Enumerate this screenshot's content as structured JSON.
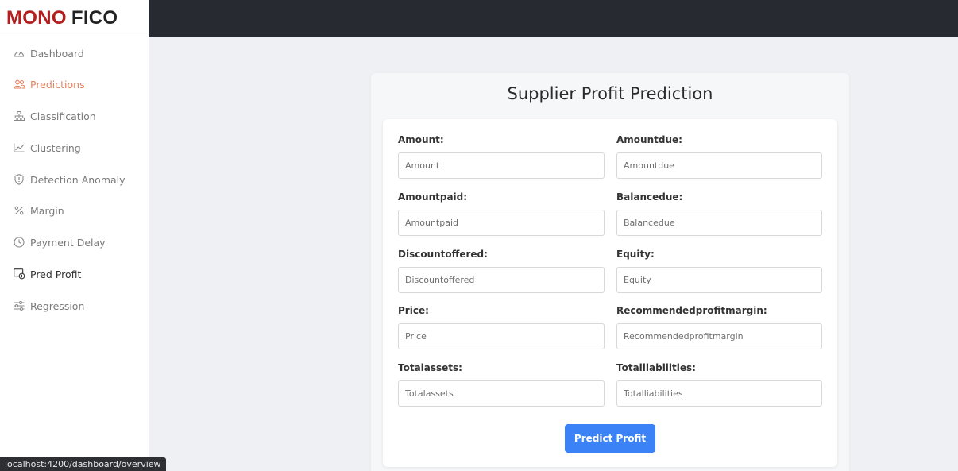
{
  "logo": {
    "part1": "MONO",
    "part2": "FICO"
  },
  "sidebar": {
    "items": [
      {
        "label": "Dashboard",
        "icon": "gauge-icon"
      },
      {
        "label": "Predictions",
        "icon": "users-icon"
      },
      {
        "label": "Classification",
        "icon": "sitemap-icon"
      },
      {
        "label": "Clustering",
        "icon": "line-chart-icon"
      },
      {
        "label": "Detection Anomaly",
        "icon": "shield-icon"
      },
      {
        "label": "Margin",
        "icon": "percent-icon"
      },
      {
        "label": "Payment Delay",
        "icon": "clock-icon"
      },
      {
        "label": "Pred Profit",
        "icon": "money-check-icon"
      },
      {
        "label": "Regression",
        "icon": "sliders-icon"
      }
    ]
  },
  "form": {
    "title": "Supplier Profit Prediction",
    "fields": [
      {
        "label": "Amount:",
        "placeholder": "Amount"
      },
      {
        "label": "Amountdue:",
        "placeholder": "Amountdue"
      },
      {
        "label": "Amountpaid:",
        "placeholder": "Amountpaid"
      },
      {
        "label": "Balancedue:",
        "placeholder": "Balancedue"
      },
      {
        "label": "Discountoffered:",
        "placeholder": "Discountoffered"
      },
      {
        "label": "Equity:",
        "placeholder": "Equity"
      },
      {
        "label": "Price:",
        "placeholder": "Price"
      },
      {
        "label": "Recommendedprofitmargin:",
        "placeholder": "Recommendedprofitmargin"
      },
      {
        "label": "Totalassets:",
        "placeholder": "Totalassets"
      },
      {
        "label": "Totalliabilities:",
        "placeholder": "Totalliabilities"
      }
    ],
    "submit_label": "Predict Profit"
  },
  "statusbar": {
    "url": "localhost:4200/dashboard/overview"
  },
  "colors": {
    "brand_red": "#b51e1e",
    "active_nav": "#e8805c",
    "button": "#3b82f6",
    "topbar": "#272a30"
  }
}
